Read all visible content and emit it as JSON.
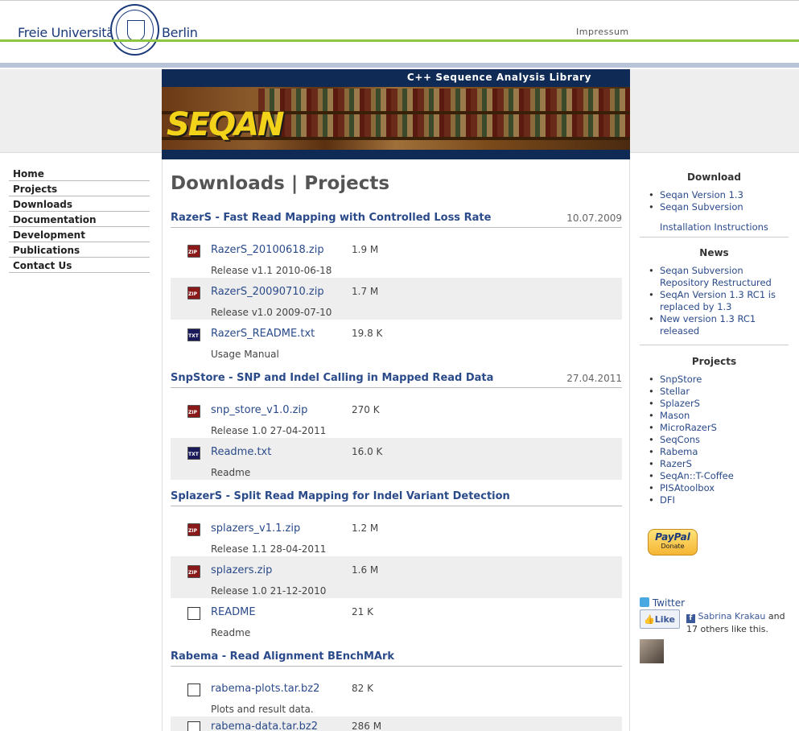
{
  "header": {
    "uni_left": "Freie Universität",
    "uni_right": "Berlin",
    "impressum": "Impressum"
  },
  "banner": {
    "title": "C++ Sequence Analysis Library",
    "logo": "SEQAN"
  },
  "nav": {
    "items": [
      "Home",
      "Projects",
      "Downloads",
      "Documentation",
      "Development",
      "Publications",
      "Contact Us"
    ]
  },
  "main": {
    "page_title": "Downloads | Projects",
    "projects": [
      {
        "title": "RazerS - Fast Read Mapping with Controlled Loss Rate",
        "date": "10.07.2009",
        "files": [
          {
            "icon": "zip-icon",
            "name": "RazerS_20100618.zip",
            "size": "1.9 M",
            "desc": "Release v1.1 2010-06-18"
          },
          {
            "icon": "zip-icon",
            "name": "RazerS_20090710.zip",
            "size": "1.7 M",
            "desc": "Release v1.0 2009-07-10"
          },
          {
            "icon": "txt-icon",
            "name": "RazerS_README.txt",
            "size": "19.8 K",
            "desc": "Usage Manual"
          }
        ]
      },
      {
        "title": "SnpStore - SNP and Indel Calling in Mapped Read Data",
        "date": "27.04.2011",
        "files": [
          {
            "icon": "zip-icon",
            "name": "snp_store_v1.0.zip",
            "size": "270 K",
            "desc": "Release 1.0 27-04-2011"
          },
          {
            "icon": "txt-icon",
            "name": "Readme.txt",
            "size": "16.0 K",
            "desc": "Readme"
          }
        ]
      },
      {
        "title": "SplazerS - Split Read Mapping for Indel Variant Detection",
        "date": "",
        "files": [
          {
            "icon": "zip-icon",
            "name": "splazers_v1.1.zip",
            "size": "1.2 M",
            "desc": "Release 1.1 28-04-2011"
          },
          {
            "icon": "zip-icon",
            "name": "splazers.zip",
            "size": "1.6 M",
            "desc": "Release 1.0 21-12-2010"
          },
          {
            "icon": "document-icon",
            "name": "README",
            "size": "21 K",
            "desc": "Readme"
          }
        ]
      },
      {
        "title": "Rabema - Read Alignment BEnchMArk",
        "date": "",
        "files": [
          {
            "icon": "document-icon",
            "name": "rabema-plots.tar.bz2",
            "size": "82 K",
            "desc": "Plots and result data."
          },
          {
            "icon": "document-icon",
            "name": "rabema-data.tar.bz2",
            "size": "286 M",
            "desc": ""
          }
        ]
      }
    ]
  },
  "sidebar": {
    "download_head": "Download",
    "download_items": [
      "Seqan Version 1.3",
      "Seqan Subversion"
    ],
    "install_link": "Installation Instructions",
    "news_head": "News",
    "news_items": [
      "Seqan Subversion Repository Restructured",
      "SeqAn Version 1.3 RC1 is replaced by 1.3",
      "New version 1.3 RC1 released"
    ],
    "projects_head": "Projects",
    "project_items": [
      "SnpStore",
      "Stellar",
      "SplazerS",
      "Mason",
      "MicroRazerS",
      "SeqCons",
      "Rabema",
      "RazerS",
      "SeqAn::T-Coffee",
      "PISAtoolbox",
      "DFI"
    ],
    "paypal_top": "PayPal",
    "paypal_bottom": "Donate",
    "twitter": "Twitter",
    "like": "Like",
    "fb_name": "Sabrina Krakau",
    "fb_rest": " and 17 others like this."
  },
  "colors": {
    "link": "#2a4a8a",
    "green_rule": "#8dc63f",
    "banner_blue": "#0e2a55"
  }
}
